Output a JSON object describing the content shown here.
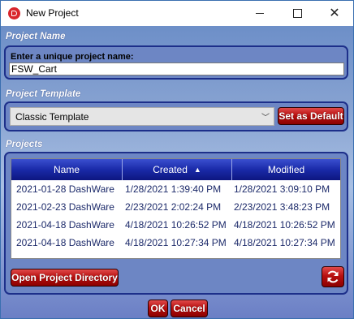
{
  "window": {
    "title": "New Project",
    "controls": [
      "minimize",
      "maximize",
      "close"
    ]
  },
  "project_name": {
    "section_label": "Project Name",
    "prompt": "Enter a unique project name:",
    "value": "FSW_Cart"
  },
  "project_template": {
    "section_label": "Project Template",
    "selected": "Classic Template",
    "set_default_label": "Set as Default"
  },
  "projects": {
    "section_label": "Projects",
    "columns": [
      "Name",
      "Created",
      "Modified"
    ],
    "sort_indicator": "▲",
    "rows": [
      {
        "name": "2021-01-28 DashWare",
        "created": "1/28/2021 1:39:40 PM",
        "modified": "1/28/2021 3:09:10 PM"
      },
      {
        "name": "2021-02-23 DashWare",
        "created": "2/23/2021 2:02:24 PM",
        "modified": "2/23/2021 3:48:23 PM"
      },
      {
        "name": "2021-04-18 DashWare",
        "created": "4/18/2021 10:26:52 PM",
        "modified": "4/18/2021 10:26:52 PM"
      },
      {
        "name": "2021-04-18 DashWare",
        "created": "4/18/2021 10:27:34 PM",
        "modified": "4/18/2021 10:27:34 PM"
      }
    ],
    "open_dir_label": "Open Project Directory",
    "refresh_icon": "refresh-icon"
  },
  "footer": {
    "ok_label": "OK",
    "cancel_label": "Cancel"
  },
  "colors": {
    "accent_red": "#b81010",
    "header_blue": "#1a2aa8",
    "panel_border": "#1d2f8a"
  }
}
